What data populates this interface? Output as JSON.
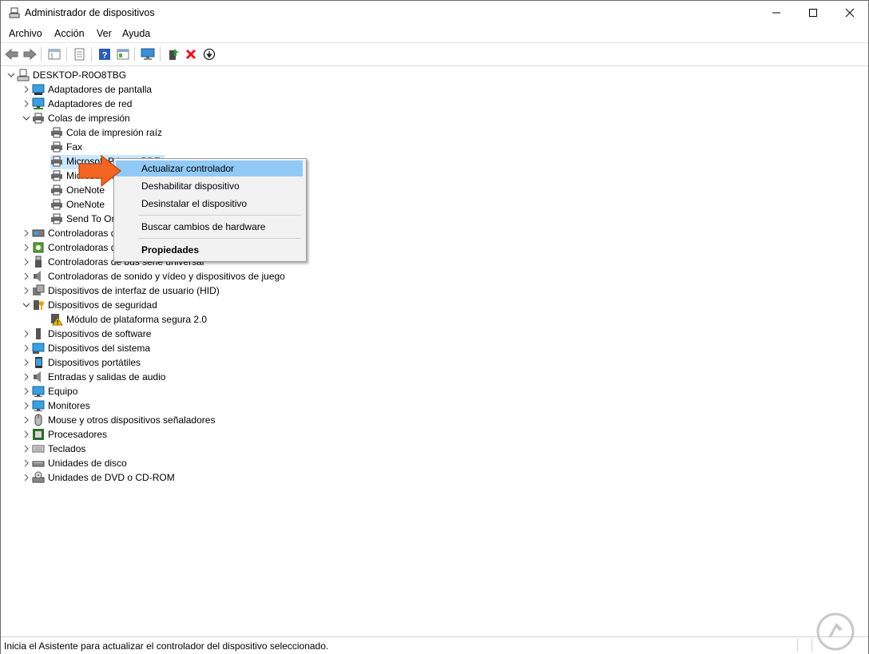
{
  "window": {
    "title": "Administrador de dispositivos"
  },
  "menu": [
    "Archivo",
    "Acción",
    "Ver",
    "Ayuda"
  ],
  "tree": {
    "root": "DESKTOP-R0O8TBG",
    "items": [
      {
        "label": "Adaptadores de pantalla",
        "icon": "display-adapter-icon"
      },
      {
        "label": "Adaptadores de red",
        "icon": "network-adapter-icon"
      },
      {
        "label": "Colas de impresión",
        "icon": "printer-icon"
      },
      {
        "label": "Cola de impresión raíz",
        "icon": "printer-icon"
      },
      {
        "label": "Fax",
        "icon": "printer-icon"
      },
      {
        "label": "Microsoft Print to PDF",
        "icon": "printer-icon"
      },
      {
        "label": "Microsoft XPS Document Writer",
        "icon": "printer-icon"
      },
      {
        "label": "OneNote",
        "icon": "printer-icon"
      },
      {
        "label": "OneNote",
        "icon": "printer-icon"
      },
      {
        "label": "Send To OneNote",
        "icon": "printer-icon"
      },
      {
        "label": "Controladoras de almacenamiento",
        "icon": "storage-controller-icon"
      },
      {
        "label": "Controladoras de almacenamiento",
        "icon": "bus-controller-icon"
      },
      {
        "label": "Controladoras de bus serie universal",
        "icon": "usb-icon"
      },
      {
        "label": "Controladoras de sonido y vídeo y dispositivos de juego",
        "icon": "speaker-icon"
      },
      {
        "label": "Dispositivos de interfaz de usuario (HID)",
        "icon": "hid-icon"
      },
      {
        "label": "Dispositivos de seguridad",
        "icon": "security-device-icon"
      },
      {
        "label": "Módulo de plataforma segura 2.0",
        "icon": "warning-icon"
      },
      {
        "label": "Dispositivos de software",
        "icon": "software-device-icon"
      },
      {
        "label": "Dispositivos del sistema",
        "icon": "system-device-icon"
      },
      {
        "label": "Dispositivos portátiles",
        "icon": "portable-device-icon"
      },
      {
        "label": "Entradas y salidas de audio",
        "icon": "speaker-icon"
      },
      {
        "label": "Equipo",
        "icon": "computer-icon"
      },
      {
        "label": "Monitores",
        "icon": "monitor-icon"
      },
      {
        "label": "Mouse y otros dispositivos señaladores",
        "icon": "mouse-icon"
      },
      {
        "label": "Procesadores",
        "icon": "processor-icon"
      },
      {
        "label": "Teclados",
        "icon": "keyboard-icon"
      },
      {
        "label": "Unidades de disco",
        "icon": "disk-drive-icon"
      },
      {
        "label": "Unidades de DVD o CD-ROM",
        "icon": "dvd-drive-icon"
      }
    ]
  },
  "context_menu": {
    "update_driver": "Actualizar controlador",
    "disable_device": "Deshabilitar dispositivo",
    "uninstall_device": "Desinstalar el dispositivo",
    "scan_hardware": "Buscar cambios de hardware",
    "properties": "Propiedades"
  },
  "status": "Inicia el Asistente para actualizar el controlador del dispositivo seleccionado.",
  "colors": {
    "selection": "#cce8ff",
    "menu_highlight": "#91c9f7",
    "arrow": "#f26522",
    "remove_red": "#e81123"
  }
}
